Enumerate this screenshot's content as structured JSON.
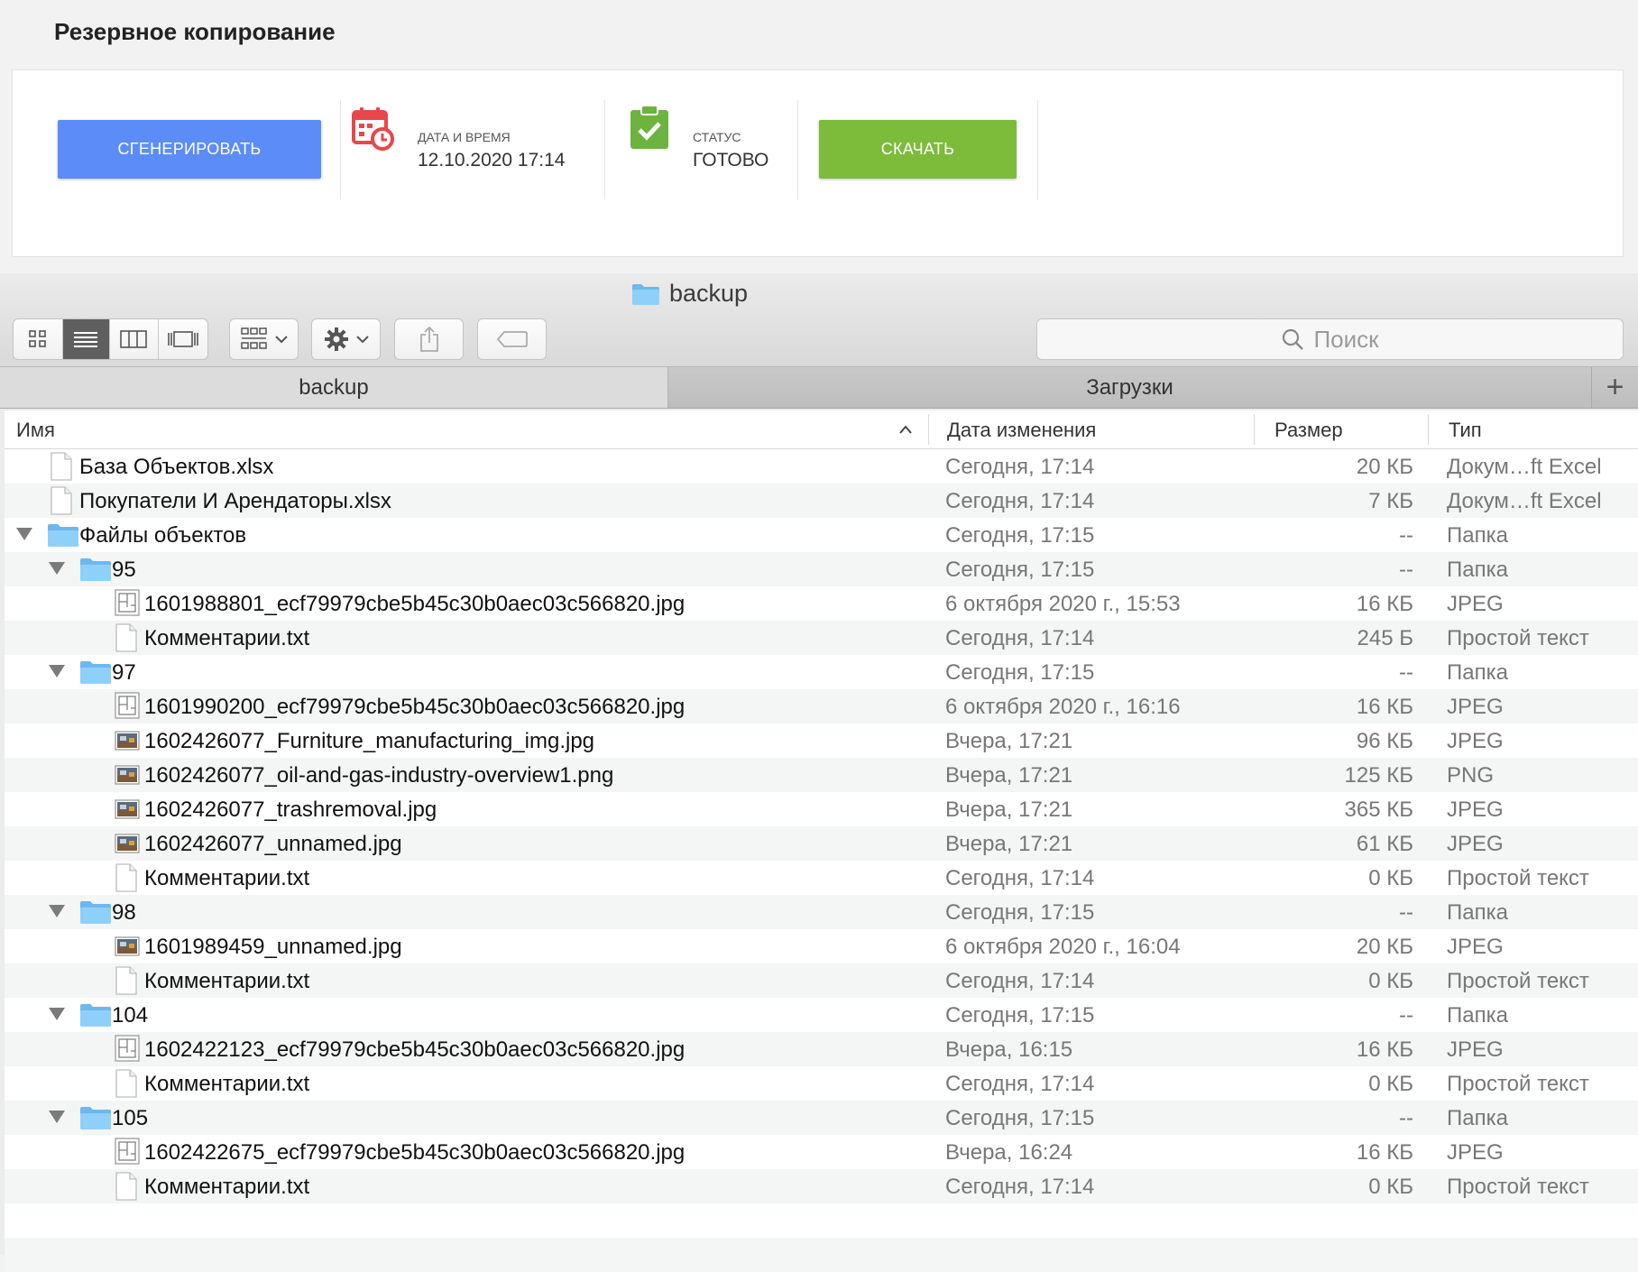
{
  "header": {
    "title": "Резервное копирование"
  },
  "backup": {
    "generate_label": "Сгенерировать",
    "datetime_label": "Дата и время",
    "datetime_value": "12.10.2020 17:14",
    "status_label": "Статус",
    "status_value": "готово",
    "download_label": "Скачать",
    "colors": {
      "generate": "#5b8cf7",
      "download": "#7dbb3b",
      "calendar_icon": "#e8474a",
      "status_icon": "#6db33f"
    }
  },
  "finder": {
    "window_title": "backup",
    "toolbar": {
      "view_buttons": [
        "icon-view-icon",
        "list-view-icon",
        "column-view-icon",
        "gallery-view-icon"
      ],
      "group_icon": "group-icon",
      "action_icon": "gear-icon",
      "share_icon": "share-icon",
      "tag_icon": "tag-icon"
    },
    "search_placeholder": "Поиск",
    "tabs": [
      {
        "label": "backup",
        "active": true
      },
      {
        "label": "Загрузки",
        "active": false
      }
    ],
    "add_tab": "+",
    "columns": {
      "name": "Имя",
      "date": "Дата изменения",
      "size": "Размер",
      "type": "Тип"
    },
    "rows": [
      {
        "level": 0,
        "kind": "doc",
        "name": "База Объектов.xlsx",
        "date": "Сегодня, 17:14",
        "size": "20 КБ",
        "type": "Докум…ft Excel"
      },
      {
        "level": 0,
        "kind": "doc",
        "name": "Покупатели И Арендаторы.xlsx",
        "date": "Сегодня, 17:14",
        "size": "7 КБ",
        "type": "Докум…ft Excel"
      },
      {
        "level": 0,
        "kind": "folder",
        "name": "Файлы объектов",
        "date": "Сегодня, 17:15",
        "size": "--",
        "type": "Папка"
      },
      {
        "level": 1,
        "kind": "folder",
        "name": "95",
        "date": "Сегодня, 17:15",
        "size": "--",
        "type": "Папка"
      },
      {
        "level": 2,
        "kind": "plan",
        "name": "1601988801_ecf79979cbe5b45c30b0aec03c566820.jpg",
        "date": "6 октября 2020 г., 15:53",
        "size": "16 КБ",
        "type": "JPEG"
      },
      {
        "level": 2,
        "kind": "doc",
        "name": "Комментарии.txt",
        "date": "Сегодня, 17:14",
        "size": "245 Б",
        "type": "Простой текст"
      },
      {
        "level": 1,
        "kind": "folder",
        "name": "97",
        "date": "Сегодня, 17:15",
        "size": "--",
        "type": "Папка"
      },
      {
        "level": 2,
        "kind": "plan",
        "name": "1601990200_ecf79979cbe5b45c30b0aec03c566820.jpg",
        "date": "6 октября 2020 г., 16:16",
        "size": "16 КБ",
        "type": "JPEG"
      },
      {
        "level": 2,
        "kind": "photo",
        "name": "1602426077_Furniture_manufacturing_img.jpg",
        "date": "Вчера, 17:21",
        "size": "96 КБ",
        "type": "JPEG"
      },
      {
        "level": 2,
        "kind": "photo",
        "name": "1602426077_oil-and-gas-industry-overview1.png",
        "date": "Вчера, 17:21",
        "size": "125 КБ",
        "type": "PNG"
      },
      {
        "level": 2,
        "kind": "photo",
        "name": "1602426077_trashremoval.jpg",
        "date": "Вчера, 17:21",
        "size": "365 КБ",
        "type": "JPEG"
      },
      {
        "level": 2,
        "kind": "photo",
        "name": "1602426077_unnamed.jpg",
        "date": "Вчера, 17:21",
        "size": "61 КБ",
        "type": "JPEG"
      },
      {
        "level": 2,
        "kind": "doc",
        "name": "Комментарии.txt",
        "date": "Сегодня, 17:14",
        "size": "0 КБ",
        "type": "Простой текст"
      },
      {
        "level": 1,
        "kind": "folder",
        "name": "98",
        "date": "Сегодня, 17:15",
        "size": "--",
        "type": "Папка"
      },
      {
        "level": 2,
        "kind": "photo",
        "name": "1601989459_unnamed.jpg",
        "date": "6 октября 2020 г., 16:04",
        "size": "20 КБ",
        "type": "JPEG"
      },
      {
        "level": 2,
        "kind": "doc",
        "name": "Комментарии.txt",
        "date": "Сегодня, 17:14",
        "size": "0 КБ",
        "type": "Простой текст"
      },
      {
        "level": 1,
        "kind": "folder",
        "name": "104",
        "date": "Сегодня, 17:15",
        "size": "--",
        "type": "Папка"
      },
      {
        "level": 2,
        "kind": "plan",
        "name": "1602422123_ecf79979cbe5b45c30b0aec03c566820.jpg",
        "date": "Вчера, 16:15",
        "size": "16 КБ",
        "type": "JPEG"
      },
      {
        "level": 2,
        "kind": "doc",
        "name": "Комментарии.txt",
        "date": "Сегодня, 17:14",
        "size": "0 КБ",
        "type": "Простой текст"
      },
      {
        "level": 1,
        "kind": "folder",
        "name": "105",
        "date": "Сегодня, 17:15",
        "size": "--",
        "type": "Папка"
      },
      {
        "level": 2,
        "kind": "plan",
        "name": "1602422675_ecf79979cbe5b45c30b0aec03c566820.jpg",
        "date": "Вчера, 16:24",
        "size": "16 КБ",
        "type": "JPEG"
      },
      {
        "level": 2,
        "kind": "doc",
        "name": "Комментарии.txt",
        "date": "Сегодня, 17:14",
        "size": "0 КБ",
        "type": "Простой текст"
      }
    ]
  }
}
